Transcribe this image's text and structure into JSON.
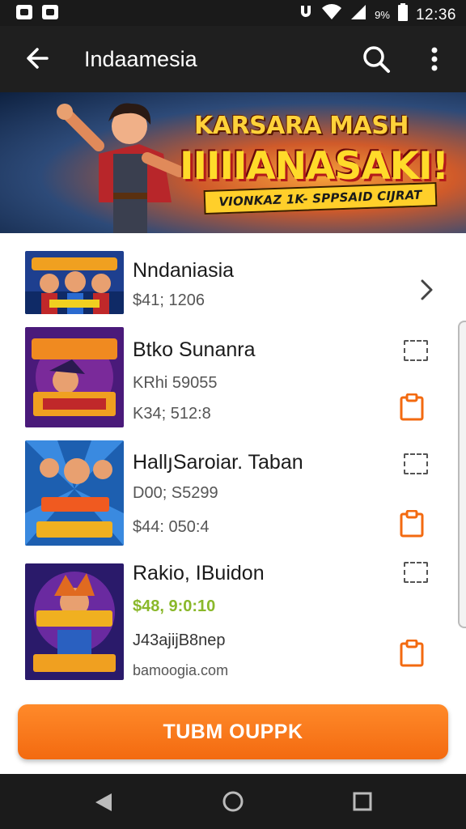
{
  "status_bar": {
    "battery_text": "9%",
    "time": "12:36",
    "icons": [
      "gallery-notification-icon",
      "photo-notification-icon",
      "data-saver-icon",
      "wifi-icon",
      "signal-icon",
      "battery-icon"
    ]
  },
  "app_bar": {
    "title": "Indaamesia",
    "icons": [
      "back-arrow-icon",
      "search-icon",
      "more-vert-icon"
    ]
  },
  "banner": {
    "line1": "KARSARA MASH",
    "line2": "IIIIIANASAKI!",
    "strip": "VIONKAZ 1K- SPPSAID CIJRAT"
  },
  "items": [
    {
      "title": "Nndaniasia",
      "line1": "$41; 1206",
      "line2": "",
      "line3": "",
      "action": "chevron-right-icon",
      "thumb_colors": [
        "#1e3f8f",
        "#f0a020"
      ]
    },
    {
      "title": "Btko Sunanra",
      "line1": "KRhi 59055",
      "line2": "K34; 512:8",
      "line3": "",
      "action": "clipboard-icon",
      "thumb_colors": [
        "#4a1a7a",
        "#f08a20"
      ]
    },
    {
      "title": "HallյSaroiar. Taban",
      "line1": "D00; S5299",
      "line2": "$44: 050:4",
      "line3": "",
      "action": "clipboard-icon",
      "thumb_colors": [
        "#1d5fb0",
        "#f05a20"
      ]
    },
    {
      "title": "Rakio, IBuidon",
      "line1": "$48, 9:0:10",
      "line2": "J43ajijB8nep",
      "line3": "bamoogia.com",
      "action": "clipboard-icon",
      "thumb_colors": [
        "#2a1a6a",
        "#f0b020"
      ]
    }
  ],
  "cta": {
    "label": "TUBM OUPPK"
  },
  "colors": {
    "accent": "#f36a10",
    "price_green": "#8ab82a",
    "app_bar": "#1f1f1f"
  }
}
